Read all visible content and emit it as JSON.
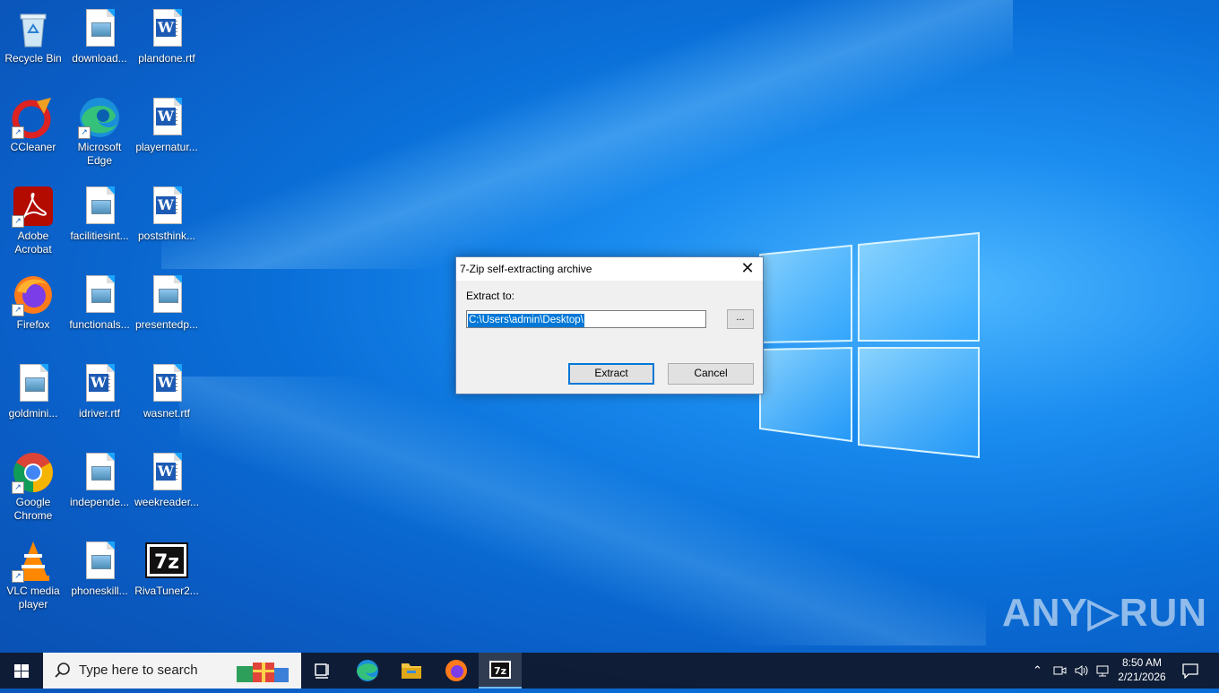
{
  "desktop": {
    "icons": [
      {
        "label": "Recycle Bin"
      },
      {
        "label": "download..."
      },
      {
        "label": "plandone.rtf"
      },
      {
        "label": "CCleaner"
      },
      {
        "label": "Microsoft Edge"
      },
      {
        "label": "playernatur..."
      },
      {
        "label": "Adobe Acrobat"
      },
      {
        "label": "facilitiesint..."
      },
      {
        "label": "poststhink..."
      },
      {
        "label": "Firefox"
      },
      {
        "label": "functionals..."
      },
      {
        "label": "presentedp..."
      },
      {
        "label": "goldmini..."
      },
      {
        "label": "idriver.rtf"
      },
      {
        "label": "wasnet.rtf"
      },
      {
        "label": "Google Chrome"
      },
      {
        "label": "independe..."
      },
      {
        "label": "weekreader..."
      },
      {
        "label": "VLC media player"
      },
      {
        "label": "phoneskill..."
      },
      {
        "label": "RivaTuner2..."
      }
    ]
  },
  "dialog": {
    "title": "7-Zip self-extracting archive",
    "close_glyph": "✕",
    "extract_label": "Extract to:",
    "path_value": "C:\\Users\\admin\\Desktop\\",
    "browse_label": "...",
    "extract_button": "Extract",
    "cancel_button": "Cancel"
  },
  "watermark": "ANY▷RUN",
  "taskbar": {
    "search_placeholder": "Type here to search",
    "time": "8:50 AM",
    "date": "2/21/2026",
    "pinned": [
      "task-view",
      "edge",
      "file-explorer",
      "firefox",
      "7zip"
    ]
  },
  "colors": {
    "accent": "#0078d7",
    "taskbar": "#101a30"
  }
}
